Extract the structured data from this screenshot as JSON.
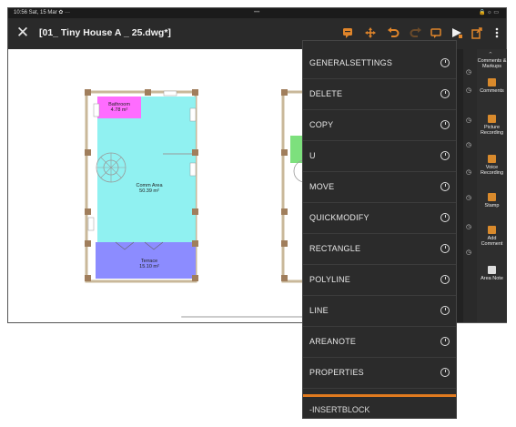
{
  "status": {
    "time": "10:56  Sat, 15 Mar  ✿ ···",
    "center": "•••",
    "right": "🔒 ☼ ▭"
  },
  "toolbar": {
    "title": "[01_ Tiny House A _ 25.dwg*]",
    "close_icon": "close-icon"
  },
  "colors": {
    "accent": "#e07a1f",
    "panel": "#2b2b2b",
    "living": "#8af0f0",
    "bathroom": "#ff66ff",
    "terrace": "#8c8cff"
  },
  "drawing": {
    "rooms": [
      {
        "name": "Bathroom",
        "area": "4.78 m²"
      },
      {
        "name": "Comm Area",
        "area": "50.39 m²"
      },
      {
        "name": "Terrace",
        "area": "15.10 m²"
      }
    ]
  },
  "menu": {
    "items": [
      "GENERALSETTINGS",
      "DELETE",
      "COPY",
      "U",
      "MOVE",
      "QUICKMODIFY",
      "RECTANGLE",
      "POLYLINE",
      "LINE",
      "AREANOTE",
      "PROPERTIES"
    ],
    "last": "-INSERTBLOCK"
  },
  "right_panel": {
    "items": [
      {
        "label": "Comments & Markups"
      },
      {
        "label": "Comments"
      },
      {
        "label": "Picture Recording"
      },
      {
        "label": "Voice Recording"
      },
      {
        "label": "Stamp"
      },
      {
        "label": "Add Comment"
      },
      {
        "label": "Area Note"
      }
    ]
  }
}
